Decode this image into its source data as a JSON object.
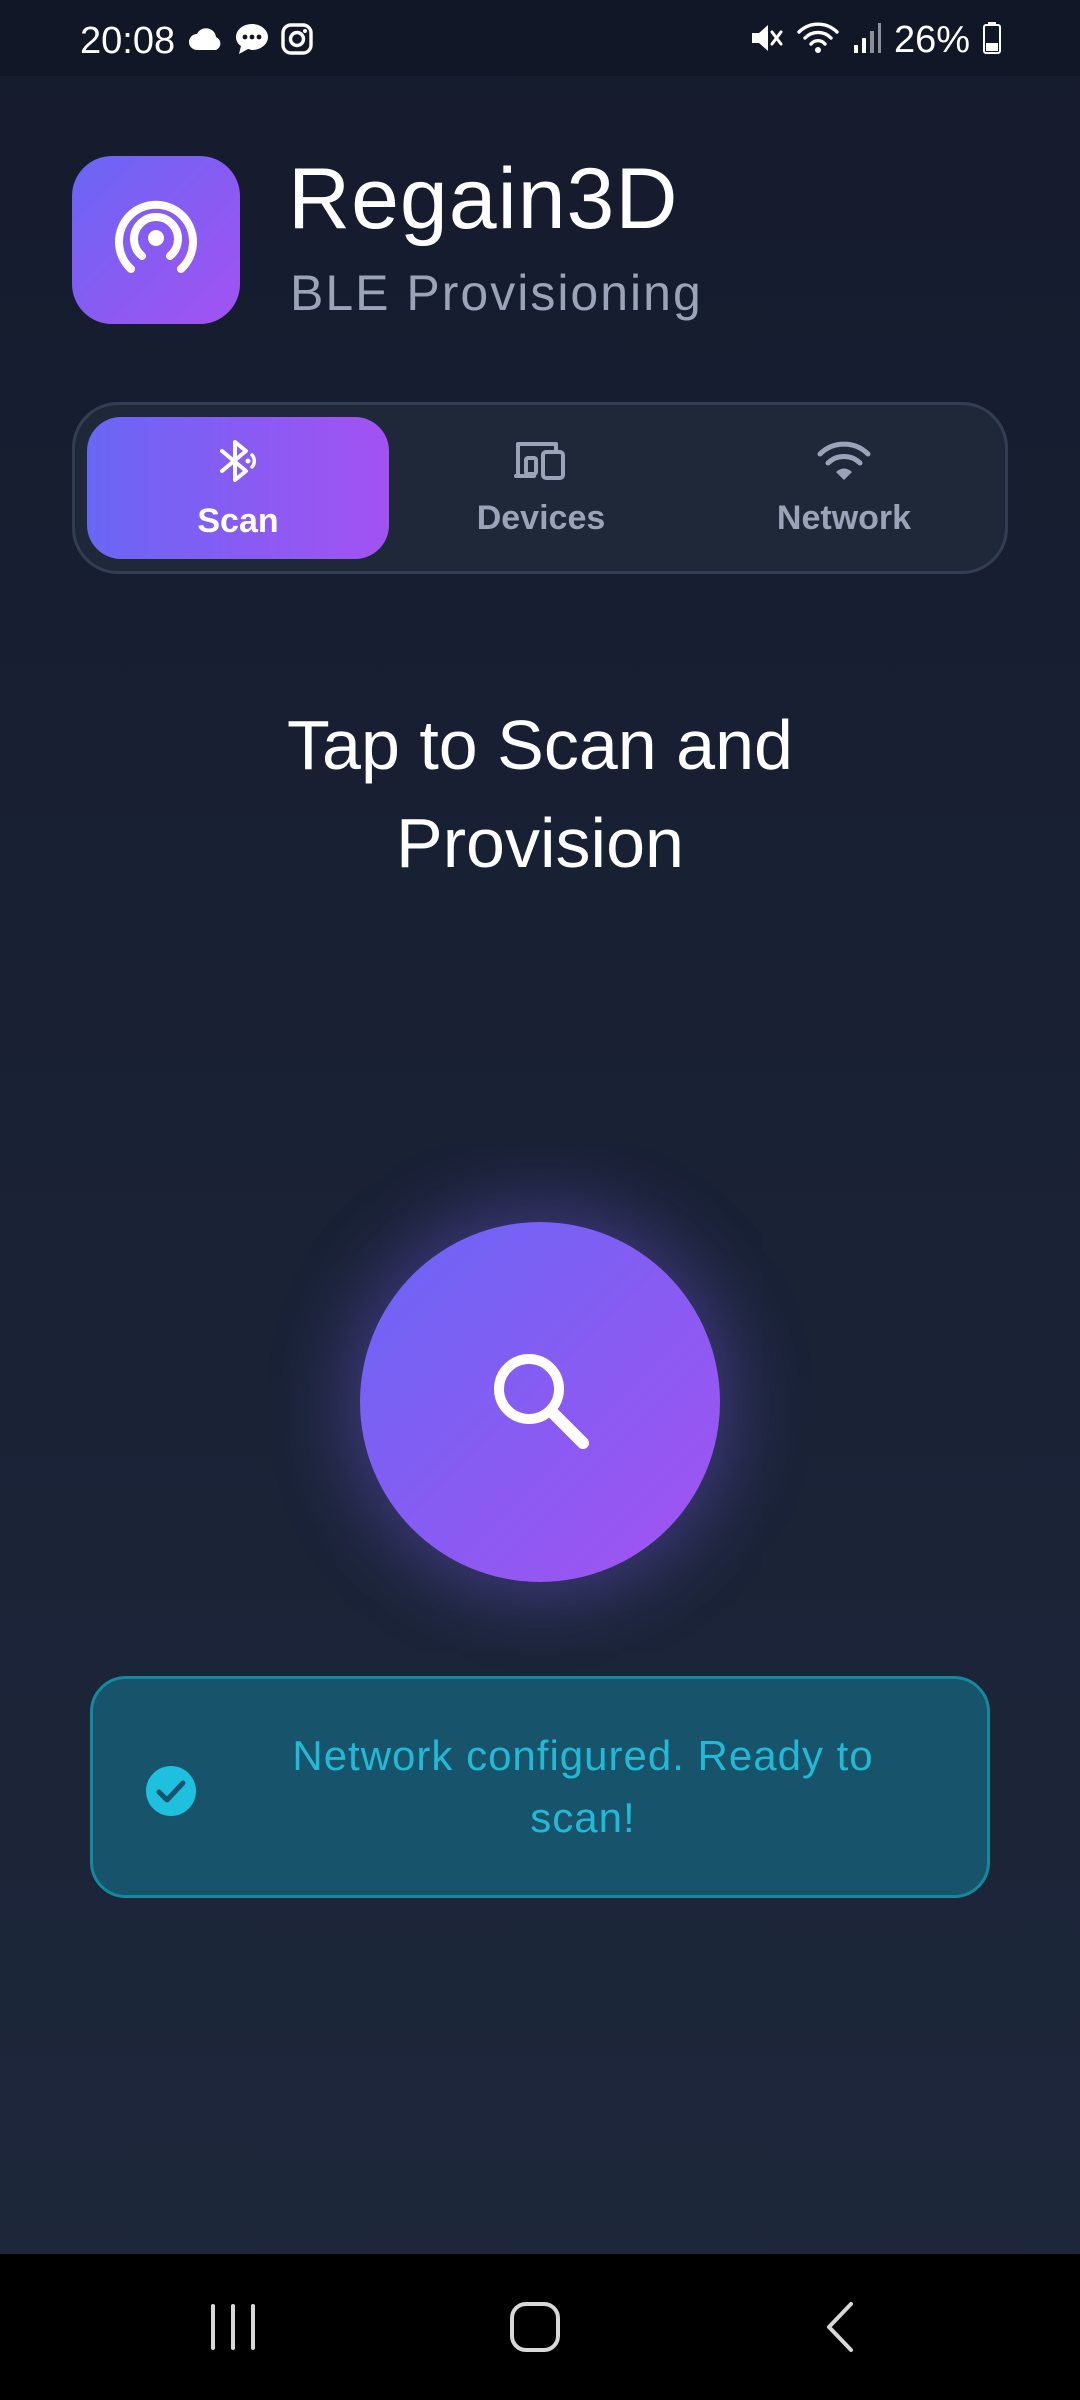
{
  "status_bar": {
    "time": "20:08",
    "battery": "26%",
    "left_icons": [
      "cloud-icon",
      "chat-icon",
      "instagram-icon"
    ],
    "right_icons": [
      "mute-icon",
      "wifi-icon",
      "signal-icon",
      "battery-icon"
    ]
  },
  "header": {
    "title": "Regain3D",
    "subtitle": "BLE Provisioning",
    "icon": "broadcast-icon"
  },
  "tabs": [
    {
      "label": "Scan",
      "icon": "bluetooth-scan-icon",
      "active": true
    },
    {
      "label": "Devices",
      "icon": "devices-icon",
      "active": false
    },
    {
      "label": "Network",
      "icon": "wifi-icon",
      "active": false
    }
  ],
  "main": {
    "heading": "Tap to Scan and Provision",
    "scan_button_icon": "search-icon"
  },
  "status": {
    "message": "Network configured. Ready to scan!",
    "icon": "check-circle-icon"
  },
  "nav": [
    "recents-icon",
    "home-icon",
    "back-icon"
  ],
  "colors": {
    "background": "#1a2236",
    "accent_start": "#6a66f4",
    "accent_end": "#a352f2",
    "status_text": "#22b9d6",
    "status_bg": "#17536a",
    "muted_text": "#9aa3b8"
  }
}
